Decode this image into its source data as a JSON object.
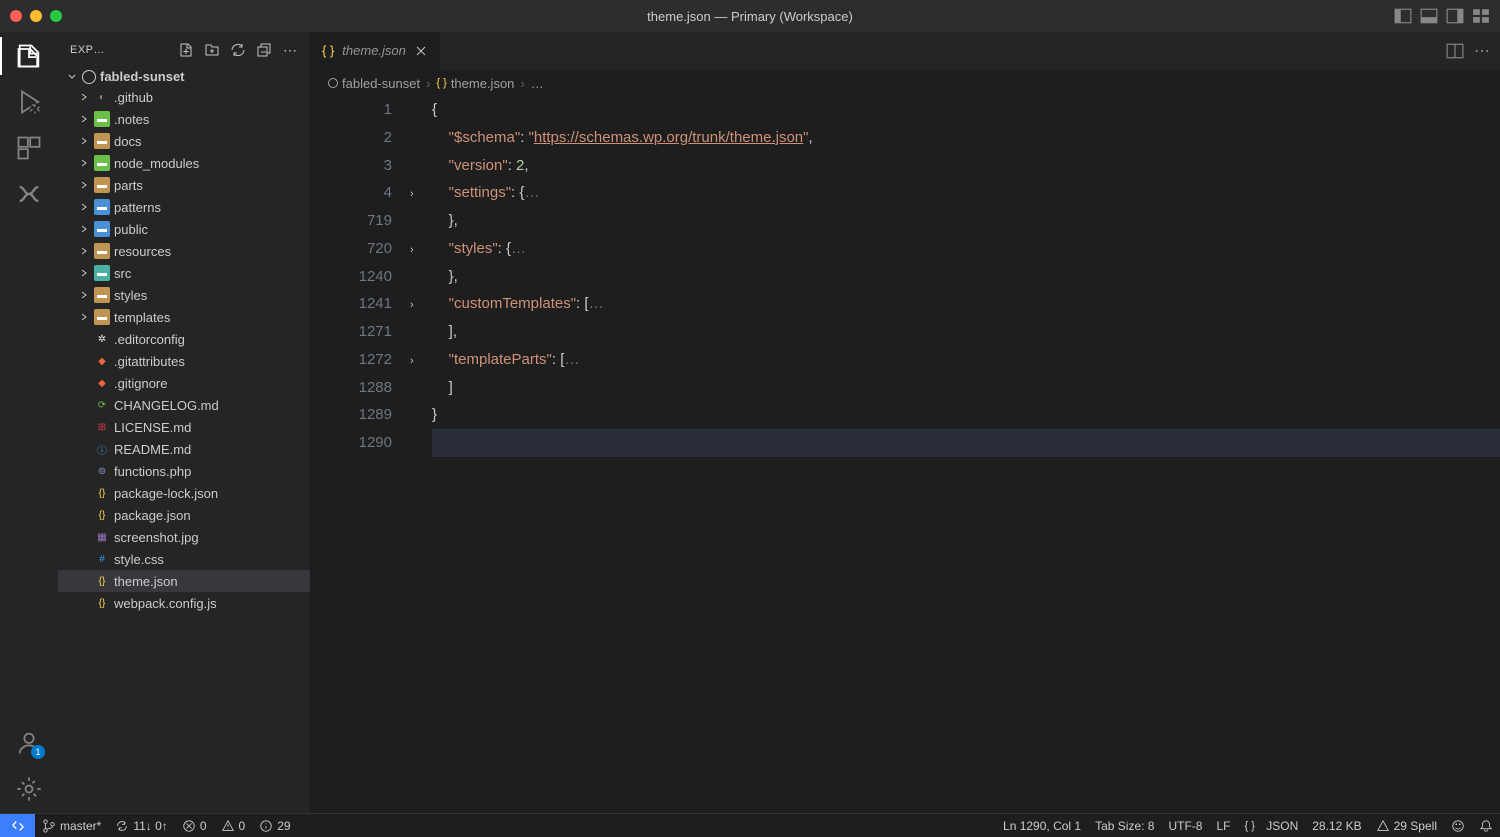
{
  "window": {
    "title": "theme.json — Primary (Workspace)"
  },
  "sidebar": {
    "title": "EXP…",
    "root_folder": "fabled-sunset",
    "folders": [
      {
        "name": ".github",
        "icon": "github"
      },
      {
        "name": ".notes",
        "icon": "folder-green"
      },
      {
        "name": "docs",
        "icon": "folder"
      },
      {
        "name": "node_modules",
        "icon": "folder-green"
      },
      {
        "name": "parts",
        "icon": "folder"
      },
      {
        "name": "patterns",
        "icon": "folder-blue"
      },
      {
        "name": "public",
        "icon": "folder-blue"
      },
      {
        "name": "resources",
        "icon": "folder"
      },
      {
        "name": "src",
        "icon": "folder-teal"
      },
      {
        "name": "styles",
        "icon": "folder"
      },
      {
        "name": "templates",
        "icon": "folder"
      }
    ],
    "files": [
      {
        "name": ".editorconfig",
        "icon": "editorconfig"
      },
      {
        "name": ".gitattributes",
        "icon": "git"
      },
      {
        "name": ".gitignore",
        "icon": "git"
      },
      {
        "name": "CHANGELOG.md",
        "icon": "changelog"
      },
      {
        "name": "LICENSE.md",
        "icon": "license"
      },
      {
        "name": "README.md",
        "icon": "readme"
      },
      {
        "name": "functions.php",
        "icon": "php"
      },
      {
        "name": "package-lock.json",
        "icon": "json"
      },
      {
        "name": "package.json",
        "icon": "json"
      },
      {
        "name": "screenshot.jpg",
        "icon": "img"
      },
      {
        "name": "style.css",
        "icon": "css"
      },
      {
        "name": "theme.json",
        "icon": "json",
        "selected": true
      },
      {
        "name": "webpack.config.js",
        "icon": "json"
      }
    ]
  },
  "tabs": [
    {
      "label": "theme.json",
      "active": true
    }
  ],
  "breadcrumbs": [
    {
      "label": "fabled-sunset",
      "icon": "circle"
    },
    {
      "label": "theme.json",
      "icon": "json"
    },
    {
      "label": "…"
    }
  ],
  "accounts_badge": "1",
  "code": {
    "lines": [
      {
        "num": "1",
        "fold": "",
        "html": "<span class='tok-punct'>{</span>"
      },
      {
        "num": "2",
        "fold": "",
        "html": "    <span class='tok-key'>\"$schema\"</span><span class='tok-punct'>: </span><span class='tok-str'>\"</span><span class='tok-url'>https://schemas.wp.org/trunk/theme.json</span><span class='tok-str'>\"</span><span class='tok-punct'>,</span>"
      },
      {
        "num": "3",
        "fold": "",
        "html": "    <span class='tok-key'>\"version\"</span><span class='tok-punct'>: </span><span class='tok-num'>2</span><span class='tok-punct'>,</span>"
      },
      {
        "num": "4",
        "fold": ">",
        "html": "    <span class='tok-key'>\"settings\"</span><span class='tok-punct'>: {</span><span class='tok-fold'>…</span>"
      },
      {
        "num": "719",
        "fold": "",
        "html": "    <span class='tok-punct'>},</span>"
      },
      {
        "num": "720",
        "fold": ">",
        "html": "    <span class='tok-key'>\"styles\"</span><span class='tok-punct'>: {</span><span class='tok-fold'>…</span>"
      },
      {
        "num": "1240",
        "fold": "",
        "html": "    <span class='tok-punct'>},</span>"
      },
      {
        "num": "1241",
        "fold": ">",
        "html": "    <span class='tok-key'>\"customTemplates\"</span><span class='tok-punct'>: [</span><span class='tok-fold'>…</span>"
      },
      {
        "num": "1271",
        "fold": "",
        "html": "    <span class='tok-punct'>],</span>"
      },
      {
        "num": "1272",
        "fold": ">",
        "html": "    <span class='tok-key'>\"templateParts\"</span><span class='tok-punct'>: [</span><span class='tok-fold'>…</span>"
      },
      {
        "num": "1288",
        "fold": "",
        "html": "    <span class='tok-punct'>]</span>"
      },
      {
        "num": "1289",
        "fold": "",
        "html": "<span class='tok-punct'>}</span>"
      },
      {
        "num": "1290",
        "fold": "",
        "html": "",
        "current": true
      }
    ]
  },
  "statusbar": {
    "branch": "master*",
    "sync": "11↓ 0↑",
    "errors": "0",
    "warnings": "0",
    "info": "29",
    "position": "Ln 1290, Col 1",
    "tab_size": "Tab Size: 8",
    "encoding": "UTF-8",
    "eol": "LF",
    "language": "JSON",
    "filesize": "28.12 KB",
    "spell": "29 Spell"
  }
}
